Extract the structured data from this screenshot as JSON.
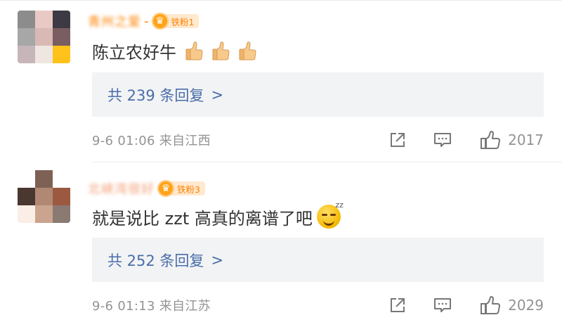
{
  "comments": [
    {
      "username": "青州之爱",
      "separator": "-",
      "badge": "铁粉1",
      "text": "陈立农好牛",
      "emoji_icons": [
        "thumbs-up-icon",
        "thumbs-up-icon",
        "thumbs-up-icon"
      ],
      "replies_label": "共 239 条回复",
      "replies_chevron": ">",
      "meta": "9-6 01:06  来自江西",
      "likes": "2017"
    },
    {
      "username": "北峡湾很好",
      "badge": "铁粉3",
      "text": "就是说比 zzt 高真的离谱了吧",
      "emoji_icons": [
        "sweat-smile-emoji-icon"
      ],
      "replies_label": "共 252 条回复",
      "replies_chevron": ">",
      "meta": "9-6 01:13  来自江苏",
      "likes": "2029"
    }
  ],
  "colors": {
    "username": "#ff8200",
    "link": "#4a6ea9",
    "meta": "#939393",
    "reply_bg": "#f2f3f5",
    "badge_bg": "#ffe9cf"
  }
}
